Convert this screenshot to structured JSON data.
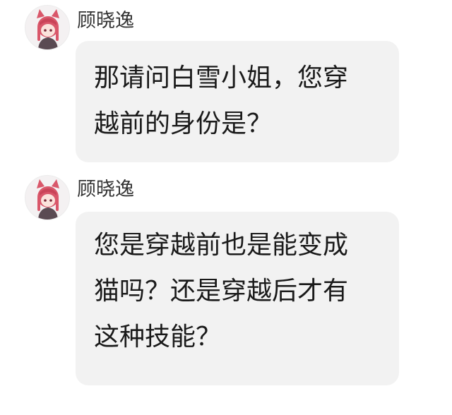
{
  "messages": [
    {
      "sender": "顾晓逸",
      "avatar_icon": "cat-ear-girl-avatar-icon",
      "lines": [
        "那请问白雪小姐，您穿",
        "越前的身份是？"
      ]
    },
    {
      "sender": "顾晓逸",
      "avatar_icon": "cat-ear-girl-avatar-icon",
      "lines": [
        "您是穿越前也是能变成",
        "猫吗？还是穿越后才有",
        "这种技能？"
      ]
    }
  ],
  "colors": {
    "bubble_bg": "#f2f2f2",
    "hair": "#d9576a",
    "text": "#1a1a1a"
  }
}
